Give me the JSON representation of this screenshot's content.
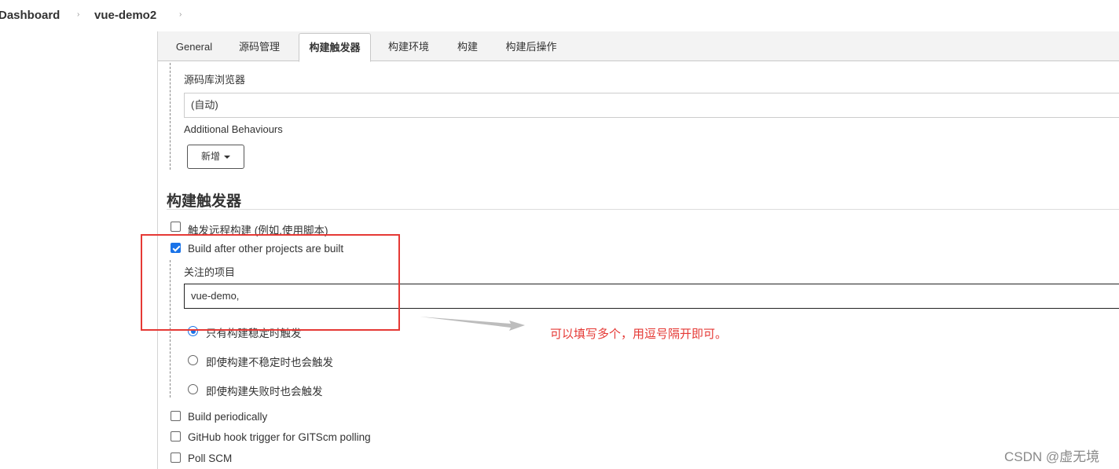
{
  "breadcrumb": {
    "items": [
      "Dashboard",
      "vue-demo2"
    ],
    "separator": "›"
  },
  "tabs": [
    {
      "label": "General",
      "active": false
    },
    {
      "label": "源码管理",
      "active": false
    },
    {
      "label": "构建触发器",
      "active": true
    },
    {
      "label": "构建环境",
      "active": false
    },
    {
      "label": "构建",
      "active": false
    },
    {
      "label": "构建后操作",
      "active": false
    }
  ],
  "scm": {
    "browser_label": "源码库浏览器",
    "browser_value": "(自动)",
    "additional_label": "Additional Behaviours",
    "add_button": "新增"
  },
  "triggers": {
    "title": "构建触发器",
    "remote_trigger": {
      "label": "触发远程构建 (例如,使用脚本)",
      "checked": false
    },
    "after_other": {
      "label": "Build after other projects are built",
      "checked": true,
      "watched_label": "关注的项目",
      "watched_value": "vue-demo,",
      "radios": [
        {
          "label": "只有构建稳定时触发",
          "selected": true
        },
        {
          "label": "即使构建不稳定时也会触发",
          "selected": false
        },
        {
          "label": "即使构建失败时也会触发",
          "selected": false
        }
      ]
    },
    "periodic": {
      "label": "Build periodically",
      "checked": false
    },
    "github_hook": {
      "label": "GitHub hook trigger for GITScm polling",
      "checked": false
    },
    "poll_scm": {
      "label": "Poll SCM",
      "checked": false
    }
  },
  "annotation": {
    "text": "可以填写多个，用逗号隔开即可。",
    "color": "#e53935"
  },
  "watermark": "CSDN @虚无境",
  "colors": {
    "accent": "#1a73e8",
    "tabbar_bg": "#f3f3f3",
    "highlight_red": "#e53935"
  }
}
